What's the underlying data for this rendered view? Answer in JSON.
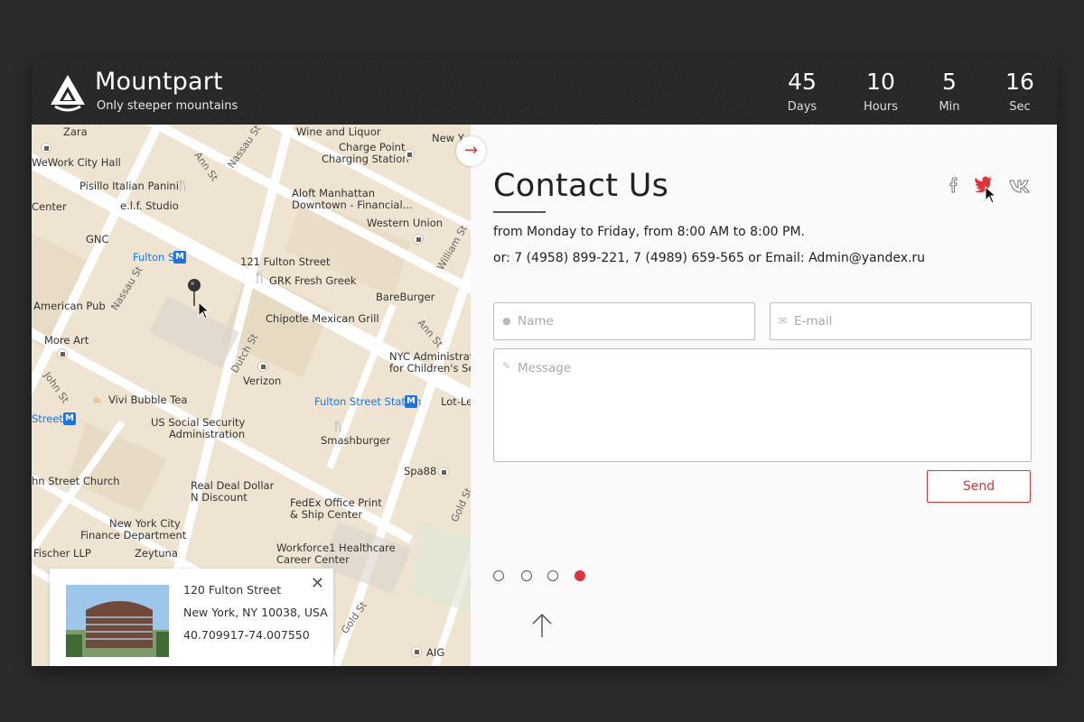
{
  "brand": {
    "name": "Mountpart",
    "tagline": "Only steeper mountains"
  },
  "countdown": [
    {
      "value": "45",
      "label": "Days"
    },
    {
      "value": "10",
      "label": "Hours"
    },
    {
      "value": "5",
      "label": "Min"
    },
    {
      "value": "16",
      "label": "Sec"
    }
  ],
  "map": {
    "places": [
      "Zara",
      "WeWork City Hall",
      "Pisillo Italian Panini",
      "e.l.f. Studio",
      "Center",
      "GNC",
      "Fulton St",
      "American Pub",
      "More Art",
      "Vivi Bubble Tea",
      "Street",
      "US Social Security",
      "Administration",
      "hn Street Church",
      "Real Deal Dollar",
      "N Discount",
      "New York City",
      "Finance Department",
      "Fischer LLP",
      "Zeytuna",
      "Wine and Liquor",
      "Charge Point",
      "Charging Station",
      "New Y",
      "Aloft Manhattan",
      "Downtown - Financial...",
      "Western Union",
      "121 Fulton Street",
      "GRK Fresh Greek",
      "BareBurger",
      "Chipotle Mexican Grill",
      "NYC Administration",
      "for Children's Serv",
      "Verizon",
      "Fulton Street Station",
      "Lot-Le",
      "Smashburger",
      "Spa88",
      "FedEx Office Print",
      "& Ship Center",
      "Workforce1 Healthcare",
      "Career Center",
      "AIG"
    ],
    "streets": [
      "Ann St",
      "Nassau St",
      "William St",
      "Nassau St",
      "Dutch St",
      "John St",
      "Ann St",
      "Gold St",
      "Gold St"
    ],
    "metro_glyph": "M"
  },
  "info_card": {
    "street": "120 Fulton Street",
    "city": "New York, NY 10038, USA",
    "coords": "40.709917-74.007550",
    "close_glyph": "✕"
  },
  "next_arrow_glyph": "→",
  "contact": {
    "title": "Contact Us",
    "hours": "from Monday to Friday, from 8:00 AM to 8:00 PM.",
    "details": "or: 7 (4958) 899-221, 7 (4989) 659-565 or Email: Admin@yandex.ru",
    "social": [
      "facebook-icon",
      "twitter-icon",
      "vk-icon"
    ],
    "accent_color": "#e2323a"
  },
  "form": {
    "name_placeholder": "Name",
    "email_placeholder": "E-mail",
    "message_placeholder": "Message",
    "send_label": "Send"
  },
  "pagination": {
    "count": 4,
    "active_index": 3
  }
}
